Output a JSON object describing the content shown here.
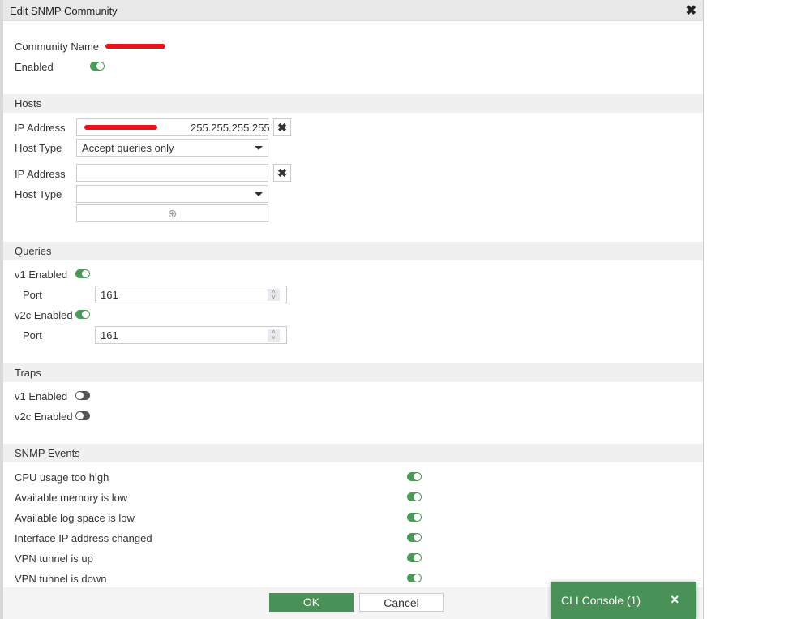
{
  "dialog": {
    "title": "Edit SNMP Community",
    "close_icon": "close-icon"
  },
  "community": {
    "name_label": "Community Name",
    "enabled_label": "Enabled",
    "enabled": true
  },
  "hosts": {
    "title": "Hosts",
    "entries": [
      {
        "ip_label": "IP Address",
        "ip_value": "255.255.255.255",
        "type_label": "Host Type",
        "type_value": "Accept queries only"
      },
      {
        "ip_label": "IP Address",
        "ip_value": "",
        "type_label": "Host Type",
        "type_value": ""
      }
    ]
  },
  "queries": {
    "title": "Queries",
    "v1_label": "v1 Enabled",
    "v1_enabled": true,
    "v1_port_label": "Port",
    "v1_port": "161",
    "v2c_label": "v2c Enabled",
    "v2c_enabled": true,
    "v2c_port_label": "Port",
    "v2c_port": "161"
  },
  "traps": {
    "title": "Traps",
    "v1_label": "v1 Enabled",
    "v1_enabled": false,
    "v2c_label": "v2c Enabled",
    "v2c_enabled": false
  },
  "events": {
    "title": "SNMP Events",
    "items": [
      {
        "label": "CPU usage too high",
        "enabled": true
      },
      {
        "label": "Available memory is low",
        "enabled": true
      },
      {
        "label": "Available log space is low",
        "enabled": true
      },
      {
        "label": "Interface IP address changed",
        "enabled": true
      },
      {
        "label": "VPN tunnel is up",
        "enabled": true
      },
      {
        "label": "VPN tunnel is down",
        "enabled": true
      }
    ]
  },
  "footer": {
    "ok": "OK",
    "cancel": "Cancel"
  },
  "cli": {
    "label": "CLI Console (1)",
    "close": "×"
  },
  "colors": {
    "accent": "#4a9157",
    "toggle_on": "#4a9a5a",
    "toggle_off": "#555555"
  }
}
